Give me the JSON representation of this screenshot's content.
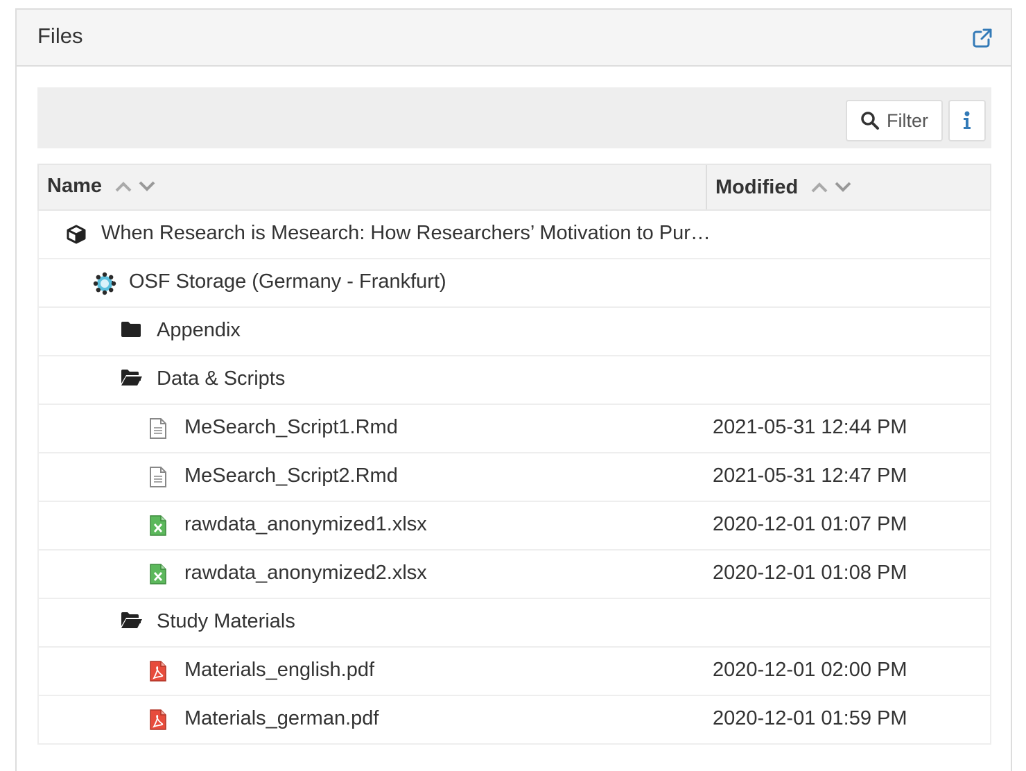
{
  "panel": {
    "title": "Files",
    "external_link_icon": "external-link-icon"
  },
  "toolbar": {
    "filter_label": "Filter",
    "info_icon": "info-icon"
  },
  "grid": {
    "columns": {
      "name": "Name",
      "modified": "Modified"
    },
    "rows": [
      {
        "level": 0,
        "type": "project",
        "name": "When Research is Mesearch: How Researchers’ Motivation to Pur…",
        "modified": "",
        "toggle": ""
      },
      {
        "level": 1,
        "type": "storage",
        "name": "OSF Storage (Germany - Frankfurt)",
        "modified": "",
        "toggle": "−"
      },
      {
        "level": 2,
        "type": "folder-closed",
        "name": "Appendix",
        "modified": "",
        "toggle": "+"
      },
      {
        "level": 2,
        "type": "folder-open",
        "name": "Data & Scripts",
        "modified": "",
        "toggle": "−"
      },
      {
        "level": 3,
        "type": "file-text",
        "name": "MeSearch_Script1.Rmd",
        "modified": "2021-05-31 12:44 PM",
        "toggle": ""
      },
      {
        "level": 3,
        "type": "file-text",
        "name": "MeSearch_Script2.Rmd",
        "modified": "2021-05-31 12:47 PM",
        "toggle": ""
      },
      {
        "level": 3,
        "type": "file-excel",
        "name": "rawdata_anonymized1.xlsx",
        "modified": "2020-12-01 01:07 PM",
        "toggle": ""
      },
      {
        "level": 3,
        "type": "file-excel",
        "name": "rawdata_anonymized2.xlsx",
        "modified": "2020-12-01 01:08 PM",
        "toggle": ""
      },
      {
        "level": 2,
        "type": "folder-open",
        "name": "Study Materials",
        "modified": "",
        "toggle": "−"
      },
      {
        "level": 3,
        "type": "file-pdf",
        "name": "Materials_english.pdf",
        "modified": "2020-12-01 02:00 PM",
        "toggle": ""
      },
      {
        "level": 3,
        "type": "file-pdf",
        "name": "Materials_german.pdf",
        "modified": "2020-12-01 01:59 PM",
        "toggle": ""
      }
    ]
  },
  "colors": {
    "link_blue": "#337ab7",
    "excel_green": "#5cb85c",
    "pdf_red": "#e74c3c",
    "storage_blue": "#5bc0de"
  }
}
